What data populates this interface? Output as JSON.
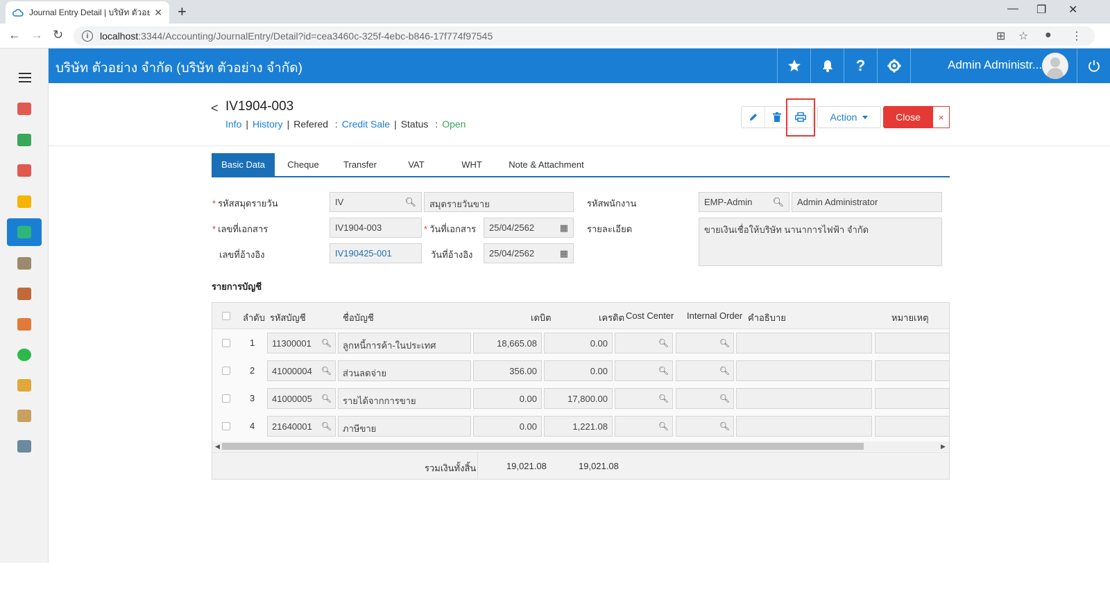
{
  "browser": {
    "tab_title": "Journal Entry Detail | บริษัท ตัวอย่าง จำกัด",
    "tab_close": "✕",
    "new_tab": "+",
    "url_host": "localhost",
    "url_path": ":3344/Accounting/JournalEntry/Detail?id=cea3460c-325f-4ebc-b846-17f774f97545"
  },
  "header": {
    "company": "บริษัท ตัวอย่าง จำกัด (บริษัท ตัวอย่าง จำกัด)",
    "user_name": "Admin Administr..."
  },
  "sidebar": {
    "items": [
      {
        "icon": "dashboard-icon",
        "color": "#e05a4f"
      },
      {
        "icon": "money-icon",
        "color": "#3aa65a"
      },
      {
        "icon": "cart-icon",
        "color": "#e05a4f"
      },
      {
        "icon": "box-icon",
        "color": "#f5b400"
      },
      {
        "icon": "book-icon",
        "color": "#2fb47c",
        "active": true
      },
      {
        "icon": "bank-icon",
        "color": "#9b8a6c"
      },
      {
        "icon": "wallet-icon",
        "color": "#c0693a"
      },
      {
        "icon": "people-icon",
        "color": "#e07a3a"
      },
      {
        "icon": "check-circle-icon",
        "color": "#2db84b"
      },
      {
        "icon": "invoice-icon",
        "color": "#e0a83a"
      },
      {
        "icon": "clipboard-icon",
        "color": "#c8a060"
      },
      {
        "icon": "tools-icon",
        "color": "#6a8aa0"
      }
    ]
  },
  "doc": {
    "back": "<",
    "number": "IV1904-003",
    "links": {
      "info": "Info",
      "history": "History",
      "refered_label": "Refered",
      "colon": ":",
      "refered_value": "Credit Sale",
      "status_label": "Status",
      "status_value": "Open",
      "sep": "|"
    }
  },
  "toolbar": {
    "action_label": "Action",
    "close_label": "Close",
    "close_x": "×"
  },
  "tabs": [
    "Basic Data",
    "Cheque",
    "Transfer",
    "VAT",
    "WHT",
    "Note & Attachment"
  ],
  "form": {
    "journal_code_label": "รหัสสมุดรายวัน",
    "journal_code_value": "IV",
    "journal_name_value": "สมุดรายวันขาย",
    "employee_code_label": "รหัสพนักงาน",
    "employee_code_value": "EMP-Admin",
    "employee_name_value": "Admin Administrator",
    "doc_no_label": "เลขที่เอกสาร",
    "doc_no_value": "IV1904-003",
    "doc_date_label": "วันที่เอกสาร",
    "doc_date_value": "25/04/2562",
    "detail_label": "รายละเอียด",
    "detail_value": "ขายเงินเชื่อให้บริษัท นานาการไฟฟ้า จำกัด",
    "ref_no_label": "เลขที่อ้างอิง",
    "ref_no_value": "IV190425-001",
    "ref_date_label": "วันที่อ้างอิง",
    "ref_date_value": "25/04/2562",
    "required_mark": "*"
  },
  "accounts": {
    "section_title": "รายการบัญชี",
    "columns": {
      "no": "ลำดับ",
      "code": "รหัสบัญชี",
      "name": "ชื่อบัญชี",
      "debit": "เดบิต",
      "credit": "เครดิต",
      "cost_center": "Cost Center",
      "internal_order": "Internal Order",
      "description": "คำอธิบาย",
      "remark": "หมายเหตุ"
    },
    "rows": [
      {
        "no": "1",
        "code": "11300001",
        "name": "ลูกหนี้การค้า-ในประเทศ",
        "debit": "18,665.08",
        "credit": "0.00"
      },
      {
        "no": "2",
        "code": "41000004",
        "name": "ส่วนลดจ่าย",
        "debit": "356.00",
        "credit": "0.00"
      },
      {
        "no": "3",
        "code": "41000005",
        "name": "รายได้จากการขาย",
        "debit": "0.00",
        "credit": "17,800.00"
      },
      {
        "no": "4",
        "code": "21640001",
        "name": "ภาษีขาย",
        "debit": "0.00",
        "credit": "1,221.08"
      }
    ],
    "total_label": "รวมเงินทั้งสิ้น",
    "total_debit": "19,021.08",
    "total_credit": "19,021.08"
  }
}
